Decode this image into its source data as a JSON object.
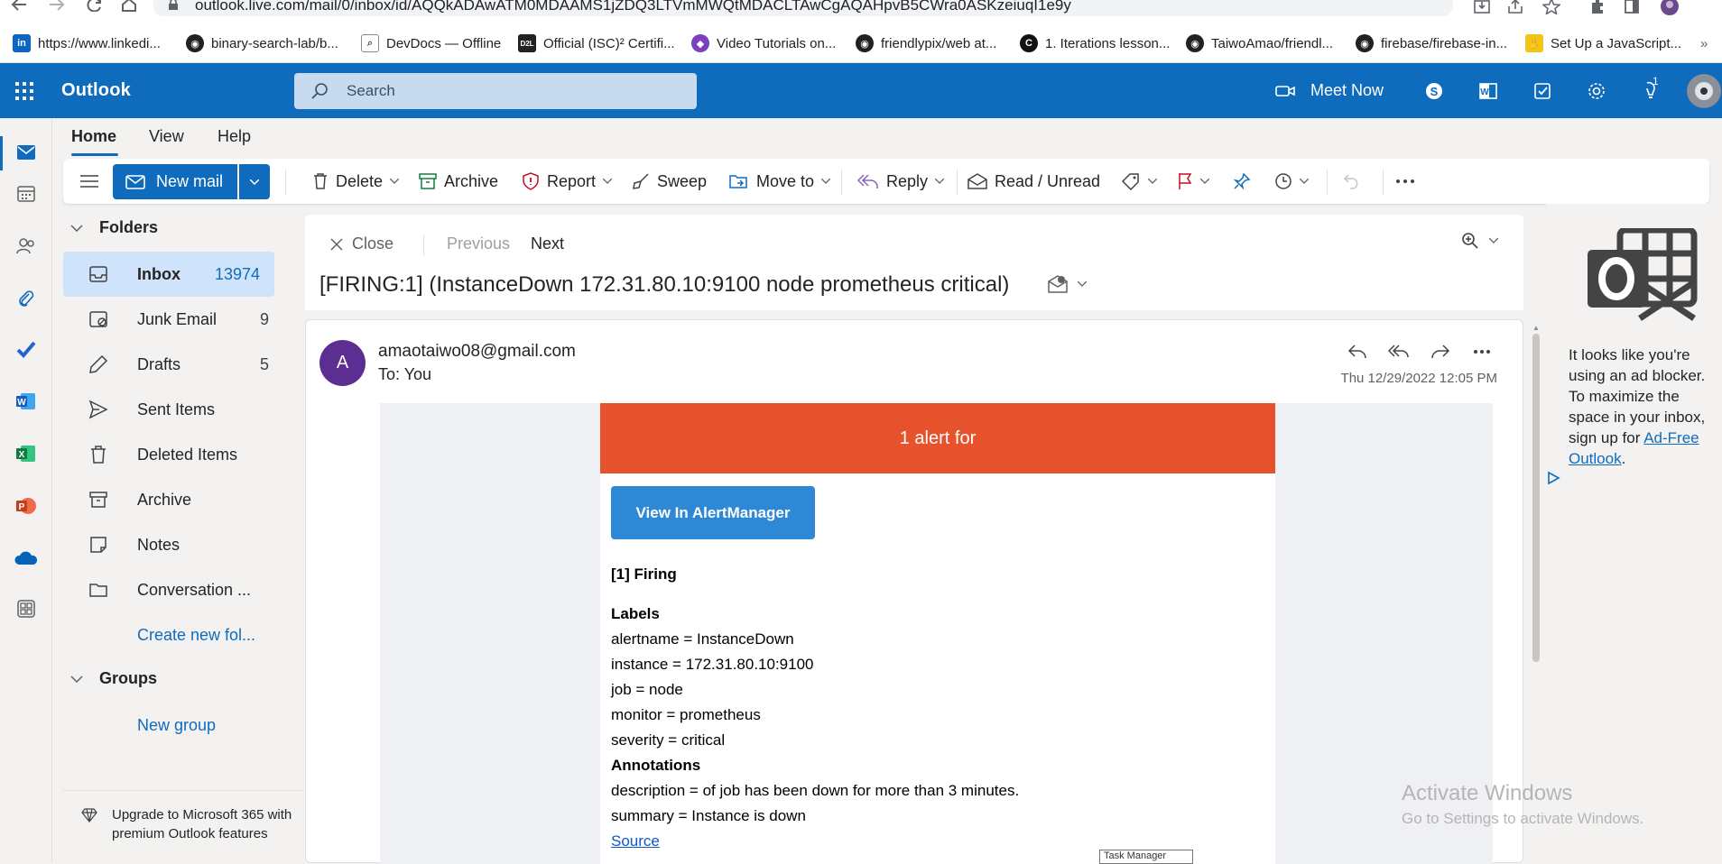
{
  "browser": {
    "url": "outlook.live.com/mail/0/inbox/id/AQQkADAwATM0MDAAMS1jZDQ3LTVmMWQtMDACLTAwCgAQAHpvB5CWra0ASKzeiuqI1e9y",
    "bookmarks": [
      {
        "label": "https://www.linkedi...",
        "icon": "linkedin-icon"
      },
      {
        "label": "binary-search-lab/b...",
        "icon": "github-icon"
      },
      {
        "label": "DevDocs — Offline",
        "icon": "devdocs-icon"
      },
      {
        "label": "Official (ISC)² Certifi...",
        "icon": "d2l-icon"
      },
      {
        "label": "Video Tutorials on...",
        "icon": "video-tutorials-icon"
      },
      {
        "label": "friendlypix/web at...",
        "icon": "github-icon"
      },
      {
        "label": "1. Iterations lesson...",
        "icon": "codecademy-icon"
      },
      {
        "label": "TaiwoAmao/friendl...",
        "icon": "github-icon"
      },
      {
        "label": "firebase/firebase-in...",
        "icon": "github-icon"
      },
      {
        "label": "Set Up a JavaScript...",
        "icon": "javascript-icon"
      }
    ]
  },
  "header": {
    "brand": "Outlook",
    "search_placeholder": "Search",
    "meet_now": "Meet Now",
    "notification_count": "1"
  },
  "tabs": {
    "home": "Home",
    "view": "View",
    "help": "Help"
  },
  "ribbon": {
    "new_mail": "New mail",
    "delete": "Delete",
    "archive": "Archive",
    "report": "Report",
    "sweep": "Sweep",
    "move_to": "Move to",
    "reply": "Reply",
    "read_unread": "Read / Unread"
  },
  "folders": {
    "section_title": "Folders",
    "items": [
      {
        "label": "Inbox",
        "count": "13974",
        "icon": "inbox-icon"
      },
      {
        "label": "Junk Email",
        "count": "9",
        "icon": "junk-icon"
      },
      {
        "label": "Drafts",
        "count": "5",
        "icon": "drafts-icon"
      },
      {
        "label": "Sent Items",
        "count": "",
        "icon": "sent-icon"
      },
      {
        "label": "Deleted Items",
        "count": "",
        "icon": "trash-icon"
      },
      {
        "label": "Archive",
        "count": "",
        "icon": "archive-icon"
      },
      {
        "label": "Notes",
        "count": "",
        "icon": "notes-icon"
      },
      {
        "label": "Conversation ...",
        "count": "",
        "icon": "folder-icon"
      }
    ],
    "create_new": "Create new fol...",
    "groups_title": "Groups",
    "new_group": "New group",
    "upgrade": "Upgrade to Microsoft 365 with premium Outlook features"
  },
  "reading": {
    "close": "Close",
    "previous": "Previous",
    "next": "Next",
    "subject": "[FIRING:1] (InstanceDown 172.31.80.10:9100 node prometheus critical)",
    "avatar_letter": "A",
    "sender": "amaotaiwo08@gmail.com",
    "to": "To:  You",
    "date": "Thu 12/29/2022 12:05 PM"
  },
  "email_body": {
    "alert_header": "1 alert for",
    "view_button": "View In AlertManager",
    "firing": "[1] Firing",
    "labels_title": "Labels",
    "labels": [
      "alertname = InstanceDown",
      "instance = 172.31.80.10:9100",
      "job = node",
      "monitor = prometheus",
      "severity = critical"
    ],
    "annotations_title": "Annotations",
    "annotations": [
      "description = of job has been down for more than 3 minutes.",
      "summary = Instance is down"
    ],
    "source_link": "Source",
    "tooltip": "Task Manager"
  },
  "ad": {
    "text": "It looks like you're using an ad blocker. To maximize the space in your inbox, sign up for",
    "link": "Ad-Free Outlook",
    "period": "."
  },
  "watermark": {
    "line1": "Activate Windows",
    "line2": "Go to Settings to activate Windows."
  },
  "colors": {
    "brand_blue": "#0f6cbd",
    "alert_orange": "#e6522c",
    "button_blue": "#2e88d6",
    "avatar_purple": "#5c2e91"
  }
}
